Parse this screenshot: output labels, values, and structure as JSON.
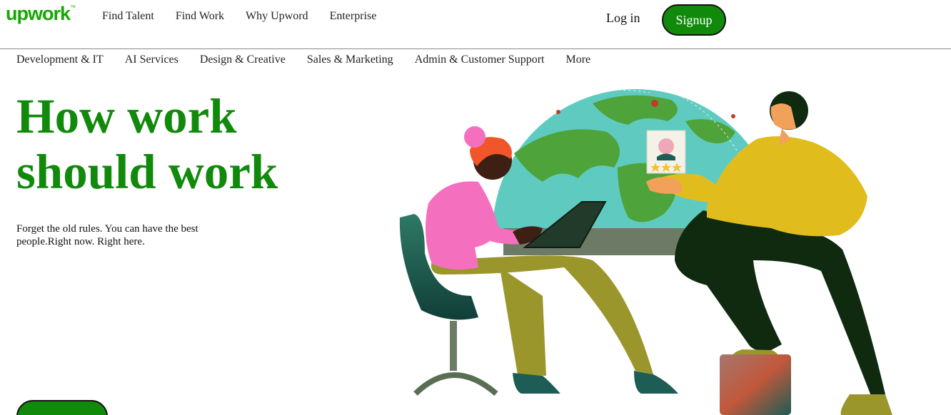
{
  "brand": {
    "logo_text": "upwork",
    "logo_mark": "™",
    "color": "#14a800"
  },
  "header": {
    "nav": [
      "Find Talent",
      "Find Work",
      "Why Upword",
      "Enterprise"
    ],
    "login_label": "Log in",
    "signup_label": "Signup"
  },
  "categories": [
    "Development & IT",
    "AI Services",
    "Design & Creative",
    "Sales & Marketing",
    "Admin & Customer Support",
    "More"
  ],
  "hero": {
    "title_line1": "How work",
    "title_line2": "should work",
    "subtitle": "Forget the old rules. You can have the best people.Right now. Right here.",
    "accent": "#118a0c",
    "illustration": "globe-with-freelancer-and-client-illustration"
  }
}
